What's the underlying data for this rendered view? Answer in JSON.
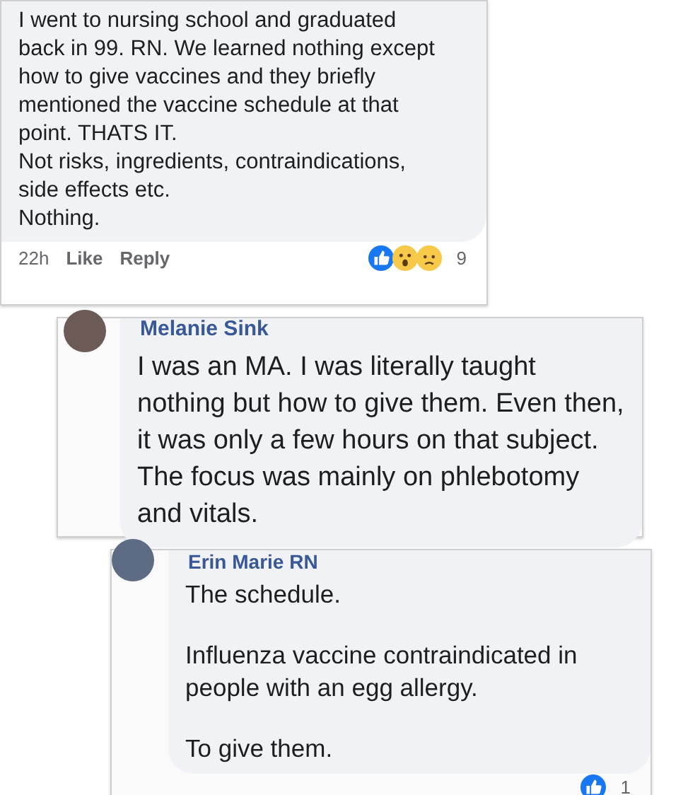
{
  "comments": [
    {
      "paragraphs": [
        "I went to nursing school and graduated back in 99. RN. We learned nothing except how to give vaccines and they briefly mentioned the vaccine schedule at that point. THATS IT.",
        "Not risks, ingredients, contraindications, side effects etc.",
        "Nothing."
      ],
      "time": "22h",
      "actions": [
        "Like",
        "Reply"
      ],
      "reactions": [
        {
          "kind": "like"
        },
        {
          "kind": "wow"
        },
        {
          "kind": "sad"
        }
      ],
      "reaction_count": "9"
    },
    {
      "author": "Melanie Sink",
      "paragraphs": [
        "I was an MA. I was literally taught nothing but how to give them. Even then, it was only a few hours on that subject. The focus was mainly on phlebotomy and vitals."
      ]
    },
    {
      "author": "Erin Marie RN",
      "paragraphs": [
        "The schedule.",
        "Influenza vaccine contraindicated in people with an egg allergy.",
        "To give them."
      ],
      "reactions": [
        {
          "kind": "like"
        }
      ],
      "reaction_count": "1"
    }
  ]
}
